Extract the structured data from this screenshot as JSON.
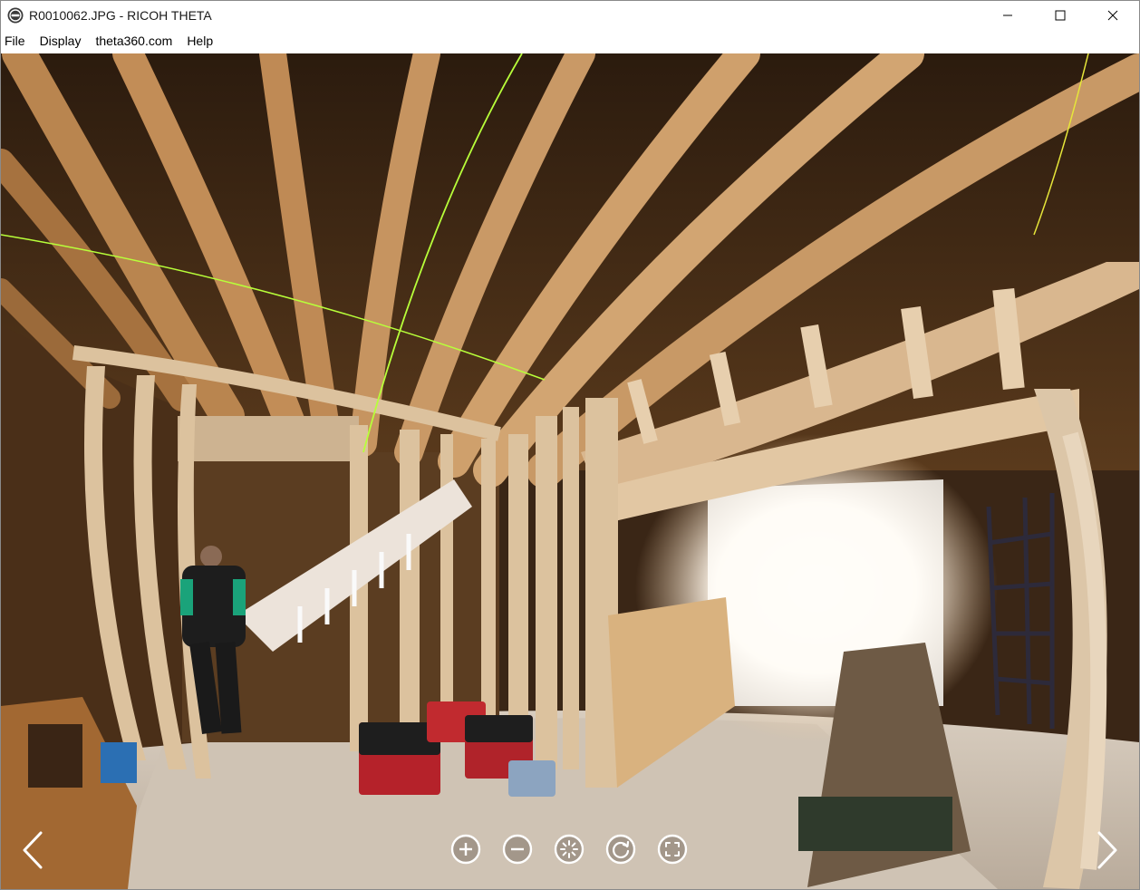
{
  "window": {
    "title": "R0010062.JPG - RICOH THETA",
    "app_icon": "ricoh-theta-icon",
    "controls": [
      "minimize-icon",
      "maximize-icon",
      "close-icon"
    ]
  },
  "menu": {
    "items": [
      {
        "label": "File"
      },
      {
        "label": "Display"
      },
      {
        "label": "theta360.com"
      },
      {
        "label": "Help"
      }
    ]
  },
  "viewer": {
    "image": "360-panorama-construction-interior",
    "navigation": {
      "previous_icon": "chevron-left-icon",
      "next_icon": "chevron-right-icon"
    },
    "toolbar": [
      {
        "icon": "zoom-in-icon"
      },
      {
        "icon": "zoom-out-icon"
      },
      {
        "icon": "auto-rotate-icon"
      },
      {
        "icon": "rotate-icon"
      },
      {
        "icon": "fullscreen-icon"
      }
    ],
    "colors": {
      "button_stroke": "#ffffff",
      "button_fill": "rgba(80,70,60,0.35)"
    }
  }
}
